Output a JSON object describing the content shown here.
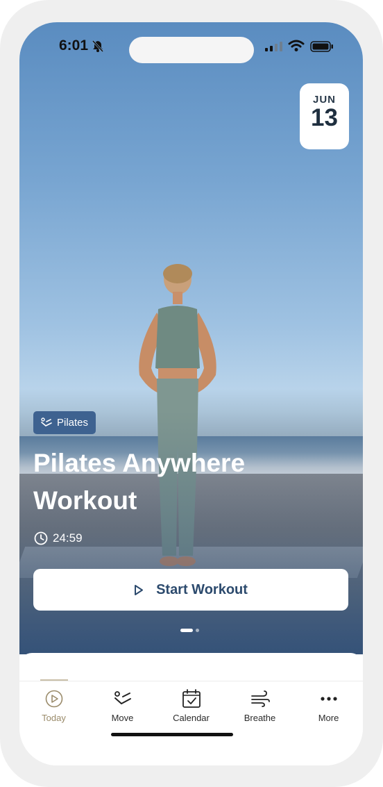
{
  "status_bar": {
    "time": "6:01"
  },
  "hero": {
    "date": {
      "month": "JUN",
      "day": "13"
    },
    "category": {
      "label": "Pilates",
      "icon": "pilates-icon"
    },
    "title": "Pilates Anywhere Workout",
    "duration": "24:59",
    "start_button": {
      "label": "Start Workout",
      "icon": "play-icon"
    },
    "pager": {
      "pages": 2,
      "active_page": 1
    }
  },
  "tabbar": {
    "items": [
      {
        "label": "Today",
        "icon": "play-circle-icon",
        "active": true
      },
      {
        "label": "Move",
        "icon": "pilates-icon",
        "active": false
      },
      {
        "label": "Calendar",
        "icon": "calendar-icon",
        "active": false
      },
      {
        "label": "Breathe",
        "icon": "wind-icon",
        "active": false
      },
      {
        "label": "More",
        "icon": "more-icon",
        "active": false
      }
    ]
  },
  "colors": {
    "accent": "#3e6290",
    "button_text": "#2c4a6d",
    "active_tab": "#9a8b6a"
  }
}
